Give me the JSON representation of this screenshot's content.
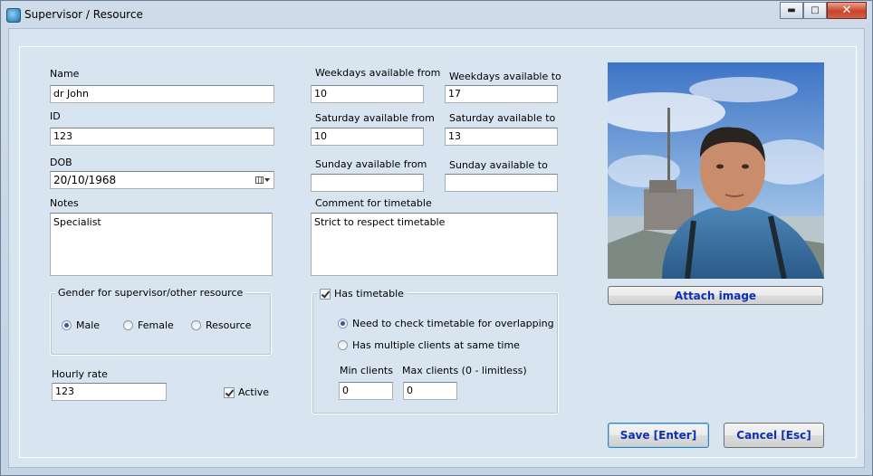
{
  "window": {
    "title": "Supervisor / Resource",
    "controls": [
      "minimize",
      "maximize",
      "close"
    ]
  },
  "form": {
    "name_label": "Name",
    "name_value": "dr John",
    "id_label": "ID",
    "id_value": "123",
    "dob_label": "DOB",
    "dob_value": "20/10/1968",
    "notes_label": "Notes",
    "notes_value": "Specialist",
    "hourly_rate_label": "Hourly rate",
    "hourly_rate_value": "123",
    "active_label": "Active",
    "active_checked": true
  },
  "gender": {
    "group_title": "Gender for supervisor/other resource",
    "options": [
      "Male",
      "Female",
      "Resource"
    ],
    "selected": "Male"
  },
  "availability": {
    "weekdays_from_label": "Weekdays available from",
    "weekdays_from_value": "10",
    "weekdays_to_label": "Weekdays available to",
    "weekdays_to_value": "17",
    "saturday_from_label": "Saturday available from",
    "saturday_from_value": "10",
    "saturday_to_label": "Saturday available to",
    "saturday_to_value": "13",
    "sunday_from_label": "Sunday available from",
    "sunday_from_value": "",
    "sunday_to_label": "Sunday available to",
    "sunday_to_value": "",
    "comment_label": "Comment for timetable",
    "comment_value": "Strict to respect timetable"
  },
  "timetable": {
    "has_timetable_label": "Has timetable",
    "has_timetable_checked": true,
    "option_overlap": "Need to check timetable for overlapping",
    "option_multiple": "Has multiple clients at same time",
    "selected": "overlap",
    "min_clients_label": "Min clients",
    "min_clients_value": "0",
    "max_clients_label": "Max clients (0 - limitless)",
    "max_clients_value": "0"
  },
  "image": {
    "attach_label": "Attach image"
  },
  "buttons": {
    "save_label": "Save [Enter]",
    "cancel_label": "Cancel [Esc]"
  },
  "icons": [
    "app-icon",
    "minimize-icon",
    "maximize-icon",
    "close-icon",
    "calendar-icon",
    "chevron-down-icon"
  ]
}
